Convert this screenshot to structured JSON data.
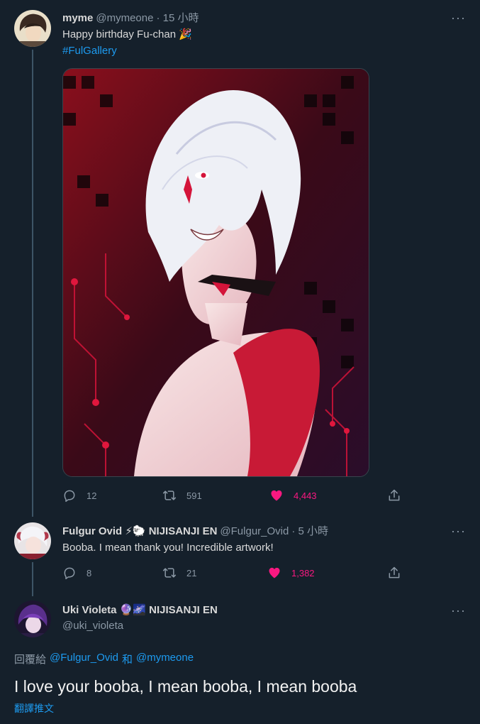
{
  "tweet1": {
    "display_name": "myme",
    "handle": "@mymeone",
    "time": "· 15 小時",
    "text": "Happy birthday Fu-chan 🎉",
    "hashtag": "#FulGallery",
    "reply_count": "12",
    "retweet_count": "591",
    "like_count": "4,443"
  },
  "tweet2": {
    "display_name": "Fulgur Ovid ⚡🐑 NIJISANJI EN",
    "handle": "@Fulgur_Ovid",
    "time": "· 5 小時",
    "text": "Booba. I mean thank you! Incredible artwork!",
    "reply_count": "8",
    "retweet_count": "21",
    "like_count": "1,382"
  },
  "tweet3": {
    "display_name": "Uki Violeta 🔮🌌 NIJISANJI EN",
    "handle": "@uki_violeta",
    "replying_prefix": "回覆給",
    "replying_user1": "@Fulgur_Ovid",
    "replying_and": "和",
    "replying_user2": "@mymeone",
    "text": "I love your booba, I mean booba, I mean booba",
    "translate": "翻譯推文"
  },
  "menu_label": "···",
  "colors": {
    "background": "#15202b",
    "link": "#1d9bf0",
    "like": "#f91880",
    "muted": "#8b98a5"
  }
}
